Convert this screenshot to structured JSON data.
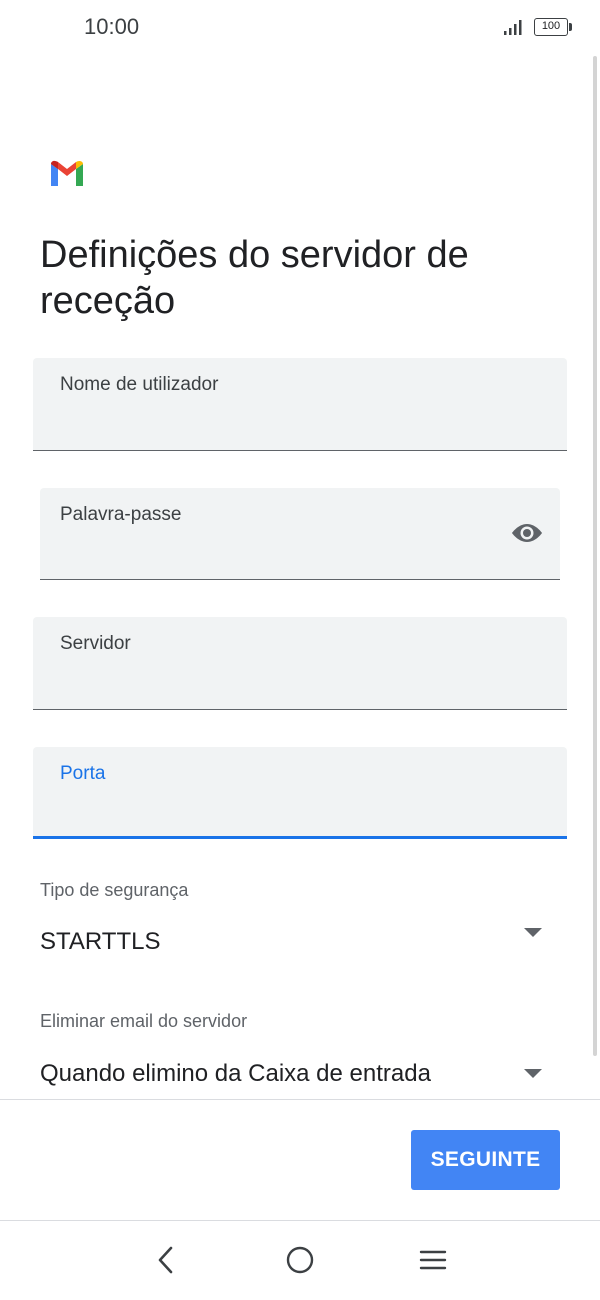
{
  "status_bar": {
    "time": "10:00",
    "battery": "100",
    "signal_icon": "signal-bars-icon"
  },
  "app": {
    "logo_icon": "gmail-logo-icon",
    "colors": {
      "blue": "#4285f4",
      "red": "#ea4335",
      "yellow": "#fbbc04",
      "green": "#34a853",
      "accent": "#1a73e8"
    }
  },
  "page": {
    "title": "Definições do servidor de receção"
  },
  "form": {
    "username": {
      "label": "Nome de utilizador",
      "value": ""
    },
    "password": {
      "label": "Palavra-passe",
      "value": "",
      "toggle_icon": "eye-icon"
    },
    "server": {
      "label": "Servidor",
      "value": ""
    },
    "port": {
      "label": "Porta",
      "value": "",
      "focused": true
    },
    "security_type": {
      "label": "Tipo de segurança",
      "value": "STARTTLS"
    },
    "delete_email": {
      "label": "Eliminar email do servidor",
      "value": "Quando elimino da Caixa de entrada"
    }
  },
  "actions": {
    "next_label": "SEGUINTE"
  },
  "nav_bar": {
    "back_icon": "back-chevron-icon",
    "home_icon": "home-circle-icon",
    "menu_icon": "menu-lines-icon"
  }
}
